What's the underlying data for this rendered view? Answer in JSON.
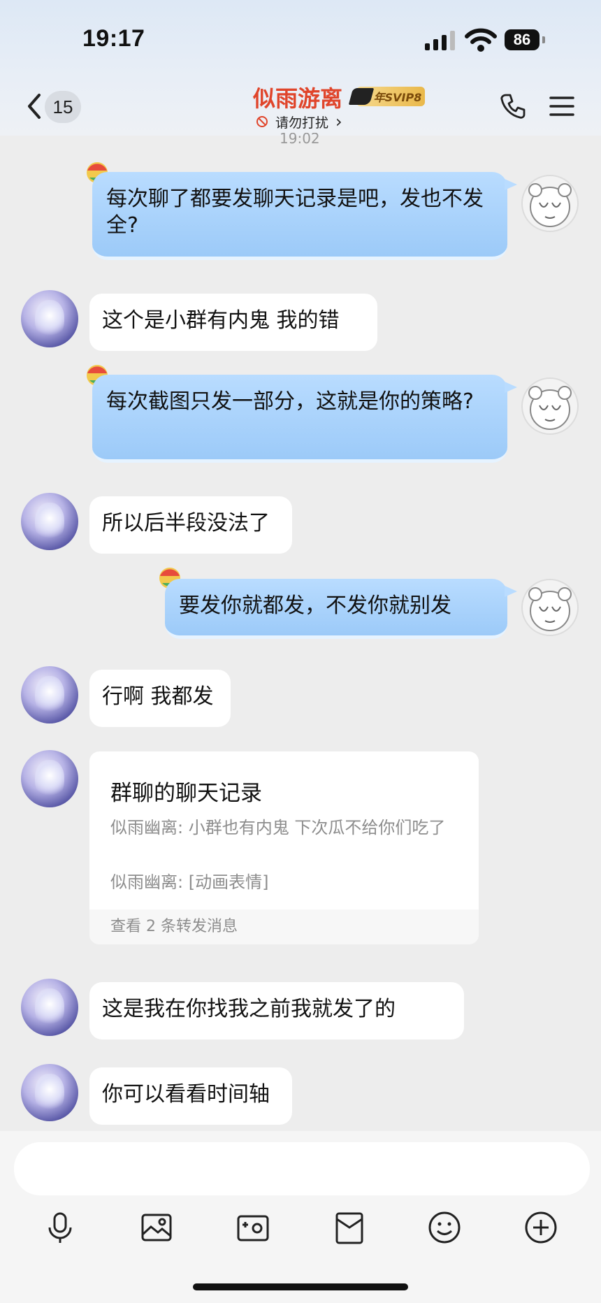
{
  "status": {
    "time": "19:17",
    "battery": "86"
  },
  "header": {
    "unread_count": "15",
    "contact_name": "似雨游离",
    "vip_badge": "年SVIP8",
    "status_text": "请勿打扰",
    "status_chevron": "›"
  },
  "messages": {
    "partial_timestamp": "19:02",
    "m1": "每次聊了都要发聊天记录是吧，发也不发全?",
    "m2": "这个是小群有内鬼 我的错",
    "m3": "每次截图只发一部分，这就是你的策略?",
    "m4": "所以后半段没法了",
    "m5": "要发你就都发，不发你就别发",
    "m6": "行啊 我都发",
    "forward": {
      "title": "群聊的聊天记录",
      "line1": "似雨幽离: 小群也有内鬼 下次瓜不给你们吃了",
      "line2": "似雨幽离: [动画表情]",
      "footer": "查看 2 条转发消息"
    },
    "m7": "这是我在你找我之前我就发了的",
    "m8": "你可以看看时间轴"
  },
  "toolbar": {
    "icons": [
      "microphone-icon",
      "image-icon",
      "camera-icon",
      "red-packet-icon",
      "emoji-icon",
      "plus-icon"
    ]
  },
  "colors": {
    "contact_name": "#e0452b",
    "bubble_self": "#a8d2fc",
    "background": "#ededed"
  }
}
